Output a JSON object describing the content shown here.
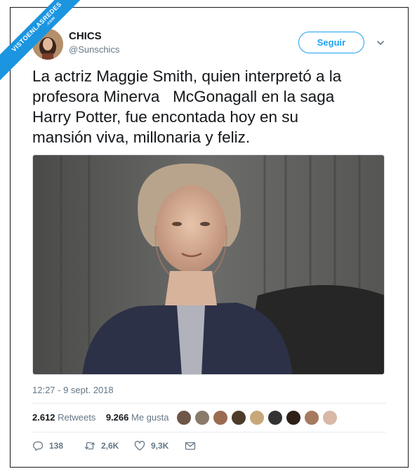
{
  "watermark": {
    "line1": "VISTOENLASREDES",
    "line2": ".com"
  },
  "author": {
    "name": "CHICS",
    "handle": "@Sunschics"
  },
  "follow_button": "Seguir",
  "tweet": {
    "text": "La actriz Maggie Smith, quien interpretó a la\nprofesora Minerva   McGonagall en la saga\nHarry Potter, fue encontada hoy en su\nmansión viva, millonaria y feliz."
  },
  "timestamp": "12:27 - 9 sept. 2018",
  "stats": {
    "retweets_count": "2.612",
    "retweets_label": "Retweets",
    "likes_count": "9.266",
    "likes_label": "Me gusta"
  },
  "actions": {
    "replies": "138",
    "retweets": "2,6K",
    "likes": "9,3K"
  },
  "colors": {
    "accent": "#1da1f2",
    "muted": "#657786",
    "ribbon": "#1b95e0"
  },
  "icons": [
    "chevron-down-icon",
    "reply-icon",
    "retweet-icon",
    "heart-icon",
    "direct-message-icon"
  ]
}
